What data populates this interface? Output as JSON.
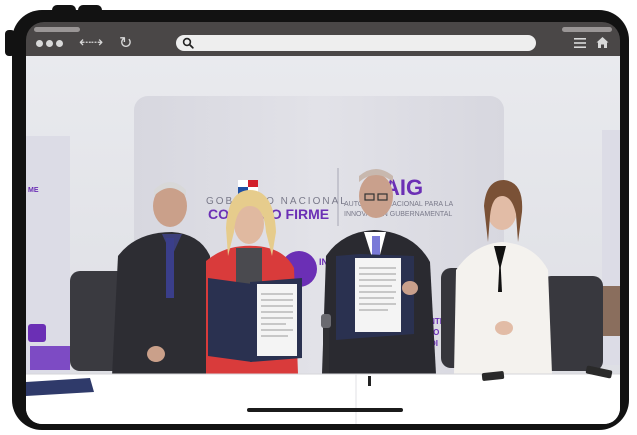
{
  "browser": {
    "search": {
      "value": "",
      "placeholder": ""
    },
    "icons": [
      "search-icon",
      "menu-icon",
      "home-icon",
      "back-icon",
      "forward-icon",
      "reload-icon"
    ]
  },
  "photo": {
    "backdrop": {
      "left_text_1": "GOBIERNO NACIONAL",
      "left_text_2": "CON PASO FIRME",
      "right_logo": "AIG",
      "right_text_1": "AUTORIDAD NACIONAL PARA LA",
      "right_text_2": "INNOVACIÓN GUBERNAMENTAL",
      "lower_left": "IN",
      "lower_right_1": "CENTRO",
      "lower_right_2": "FICIO",
      "lower_right_3": "MEDI"
    },
    "side_banner_left": "ME",
    "colors": {
      "accent_purple": "#6b2fb5",
      "flag_red": "#d21f2a",
      "flag_blue": "#1e4fa3"
    }
  }
}
